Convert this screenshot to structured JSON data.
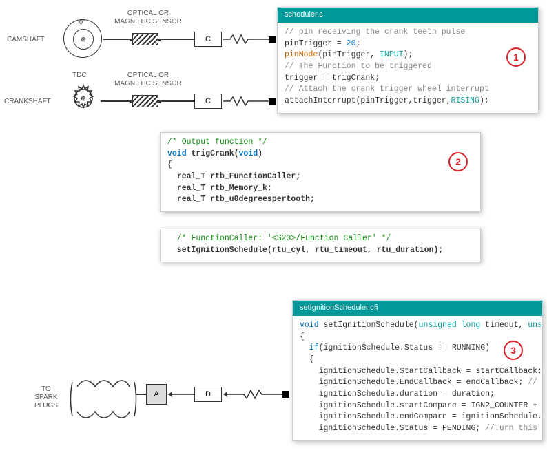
{
  "hardware": {
    "camshaft_label": "CAMSHAFT",
    "tdc_label": "TDC",
    "crankshaft_label": "CRANKSHAFT",
    "sensor_label": "OPTICAL OR\nMAGNETIC SENSOR",
    "camshaft_zero": "0°",
    "block_c": "C",
    "block_a": "A",
    "block_d": "D",
    "spark_label": "TO\nSPARK\nPLUGS"
  },
  "panel1": {
    "filename": "scheduler.c",
    "badge": "1",
    "lines": {
      "l1": "// pin receiving the crank teeth pulse",
      "l2a": "pinTrigger = ",
      "l2b": "20",
      "l2c": ";",
      "l3a": "pinMode",
      "l3b": "(pinTrigger, ",
      "l3c": "INPUT",
      "l3d": ");",
      "l4": "// The Function to be triggered",
      "l5": "trigger = trigCrank;",
      "l6": "// Attach the crank trigger wheel interrupt",
      "l7a": "attachInterrupt(pinTrigger,trigger,",
      "l7b": "RISING",
      "l7c": ");"
    }
  },
  "panel2a": {
    "badge": "2",
    "lines": {
      "l1": "/* Output function */",
      "l2a": "void",
      "l2b": " trigCrank(",
      "l2c": "void",
      "l2d": ")",
      "l3": "{",
      "l4": "  real_T rtb_FunctionCaller;",
      "l5": "  real_T rtb_Memory_k;",
      "l6": "  real_T rtb_u0degreespertooth;"
    }
  },
  "panel2b": {
    "lines": {
      "l1": "  /* FunctionCaller: '<S23>/Function Caller' */",
      "l2": "  setIgnitionSchedule(rtu_cyl, rtu_timeout, rtu_duration);"
    }
  },
  "panel3": {
    "filename": "setIgnitionScheduler.c§",
    "badge": "3",
    "lines": {
      "l1a": "void",
      "l1b": " setIgnitionSchedule(",
      "l1c": "unsigned long",
      "l1d": " timeout, ",
      "l1e": "unsi",
      "l2": "{",
      "l3a": "  if",
      "l3b": "(ignitionSchedule.Status != RUNNING)",
      "l4": "  {",
      "l5": "    ignitionSchedule.StartCallback = startCallback;",
      "l6a": "    ignitionSchedule.EndCallback = endCallback; ",
      "l6b": "// e",
      "l7": "    ignitionSchedule.duration = duration;",
      "l8": "    ignitionSchedule.startCompare = IGN2_COUNTER +",
      "l9": "    ignitionSchedule.endCompare = ignitionSchedule.",
      "l10a": "    ignitionSchedule.Status = PENDING; ",
      "l10b": "//Turn this "
    }
  }
}
